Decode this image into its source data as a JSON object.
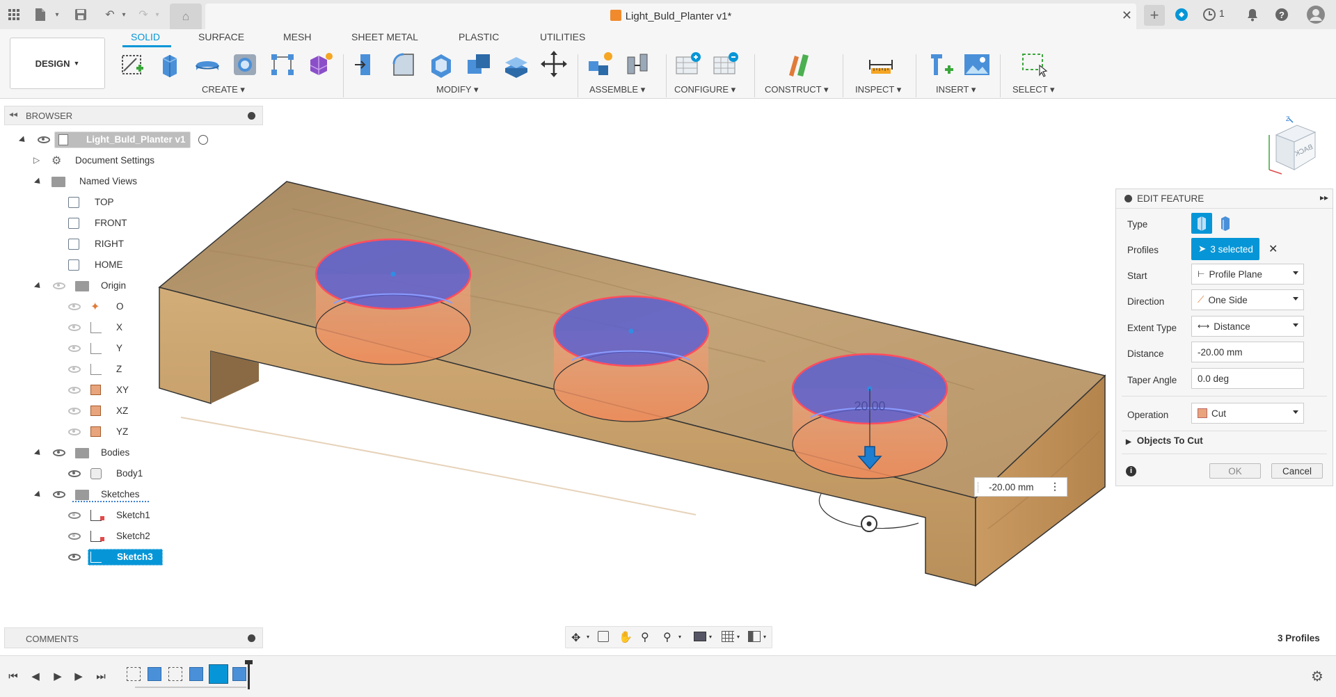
{
  "window": {
    "document_title": "Light_Buld_Planter v1*",
    "notification_count": "1"
  },
  "workspace": {
    "mode_label": "DESIGN",
    "tabs": [
      "SOLID",
      "SURFACE",
      "MESH",
      "SHEET METAL",
      "PLASTIC",
      "UTILITIES"
    ],
    "active_tab": "SOLID"
  },
  "toolbar": {
    "groups": {
      "create": "CREATE",
      "modify": "MODIFY",
      "assemble": "ASSEMBLE",
      "configure": "CONFIGURE",
      "construct": "CONSTRUCT",
      "inspect": "INSPECT",
      "insert": "INSERT",
      "select": "SELECT"
    }
  },
  "browser": {
    "title": "BROWSER",
    "root": "Light_Buld_Planter v1",
    "items": {
      "document_settings": "Document Settings",
      "named_views": "Named Views",
      "view_top": "TOP",
      "view_front": "FRONT",
      "view_right": "RIGHT",
      "view_home": "HOME",
      "origin": "Origin",
      "origin_o": "O",
      "origin_x": "X",
      "origin_y": "Y",
      "origin_z": "Z",
      "origin_xy": "XY",
      "origin_xz": "XZ",
      "origin_yz": "YZ",
      "bodies": "Bodies",
      "body1": "Body1",
      "sketches": "Sketches",
      "sketch1": "Sketch1",
      "sketch2": "Sketch2",
      "sketch3": "Sketch3"
    }
  },
  "comments": {
    "title": "COMMENTS"
  },
  "edit_feature": {
    "title": "EDIT FEATURE",
    "type_label": "Type",
    "profiles_label": "Profiles",
    "profiles_value": "3 selected",
    "start_label": "Start",
    "start_value": "Profile Plane",
    "direction_label": "Direction",
    "direction_value": "One Side",
    "extent_label": "Extent Type",
    "extent_value": "Distance",
    "distance_label": "Distance",
    "distance_value": "-20.00 mm",
    "taper_label": "Taper Angle",
    "taper_value": "0.0 deg",
    "operation_label": "Operation",
    "operation_value": "Cut",
    "objects_label": "Objects To Cut",
    "ok": "OK",
    "cancel": "Cancel"
  },
  "viewport": {
    "distance_tag": "-20.00 mm",
    "dimension_text": "20.00",
    "viewcube_face": "BACK"
  },
  "status": {
    "profiles": "3 Profiles"
  },
  "colors": {
    "accent": "#0696d7",
    "wood": "#c9a46e",
    "profile_fill": "#5a5fd0",
    "cut_fill": "#f0905a"
  }
}
